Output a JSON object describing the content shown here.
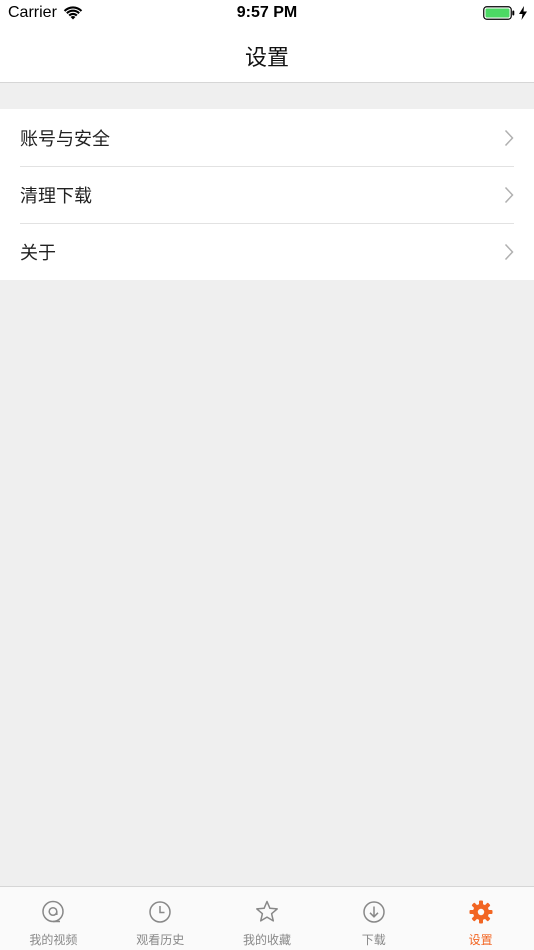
{
  "status_bar": {
    "carrier": "Carrier",
    "time": "9:57 PM",
    "battery_color": "#4cd964"
  },
  "nav": {
    "title": "设置"
  },
  "settings": {
    "items": [
      {
        "label": "账号与安全",
        "icon": "chevron-right-icon"
      },
      {
        "label": "清理下载",
        "icon": "chevron-right-icon"
      },
      {
        "label": "关于",
        "icon": "chevron-right-icon"
      }
    ]
  },
  "tab_bar": {
    "accent_color": "#f26522",
    "inactive_color": "#888888",
    "active_index": 4,
    "tabs": [
      {
        "label": "我的视频",
        "icon": "video-bubble-icon"
      },
      {
        "label": "观看历史",
        "icon": "clock-icon"
      },
      {
        "label": "我的收藏",
        "icon": "star-icon"
      },
      {
        "label": "下载",
        "icon": "download-icon"
      },
      {
        "label": "设置",
        "icon": "gear-icon"
      }
    ]
  }
}
